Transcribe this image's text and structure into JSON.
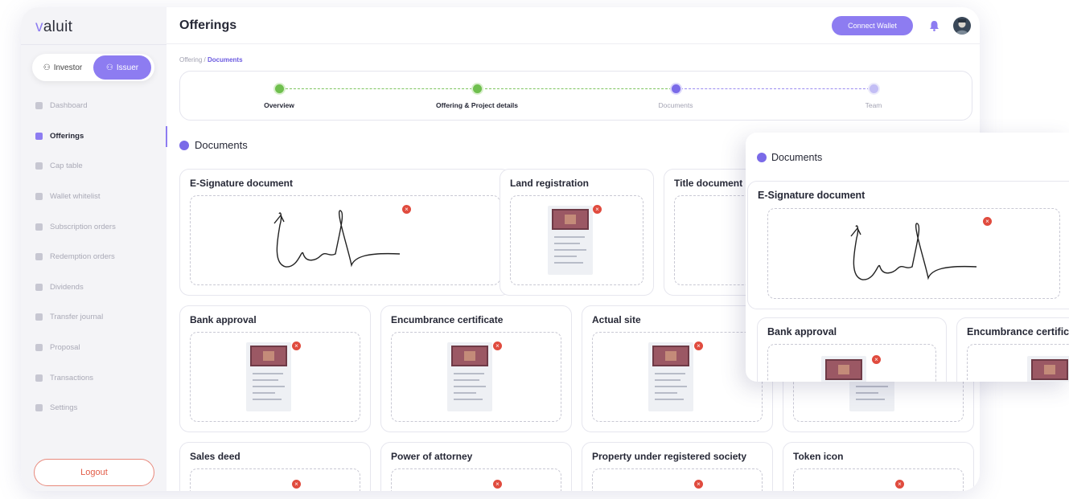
{
  "app": {
    "logo": "aluit",
    "logo_prefix": "v"
  },
  "sidebar": {
    "roles": {
      "investor": "Investor",
      "issuer": "Issuer"
    },
    "items": [
      {
        "label": "Dashboard",
        "icon": "dashboard-icon"
      },
      {
        "label": "Offerings",
        "icon": "offerings-icon",
        "active": true
      },
      {
        "label": "Cap table",
        "icon": "pie-icon"
      },
      {
        "label": "Wallet whitelist",
        "icon": "wallet-icon"
      },
      {
        "label": "Subscription orders",
        "icon": "orders-icon"
      },
      {
        "label": "Redemption orders",
        "icon": "redemption-icon"
      },
      {
        "label": "Dividends",
        "icon": "dividends-icon"
      },
      {
        "label": "Transfer journal",
        "icon": "journal-icon"
      },
      {
        "label": "Proposal",
        "icon": "proposal-icon"
      },
      {
        "label": "Transactions",
        "icon": "transactions-icon"
      },
      {
        "label": "Settings",
        "icon": "gear-icon"
      }
    ],
    "logout": "Logout"
  },
  "header": {
    "title": "Offerings",
    "connect_wallet": "Connect Wallet"
  },
  "breadcrumb": {
    "parent": "Offering",
    "sep": " / ",
    "current": "Documents"
  },
  "stepper": {
    "steps": [
      {
        "label": "Overview",
        "state": "done"
      },
      {
        "label": "Offering & Project details",
        "state": "done"
      },
      {
        "label": "Documents",
        "state": "current"
      },
      {
        "label": "Team",
        "state": "todo"
      }
    ]
  },
  "documents": {
    "heading": "Documents",
    "cards": [
      "E-Signature document",
      "Land registration",
      "Title document",
      "Bank approval",
      "Encumbrance certificate",
      "Actual site",
      "Sales deed",
      "Power of attorney",
      "Property under registered society",
      "Token icon"
    ]
  },
  "overlay": {
    "heading": "Documents",
    "cards": [
      "E-Signature document",
      "Bank approval",
      "Encumbrance certificate"
    ]
  },
  "colors": {
    "accent": "#8d7cf1",
    "done": "#6fbf4e",
    "danger": "#e04b3e"
  }
}
